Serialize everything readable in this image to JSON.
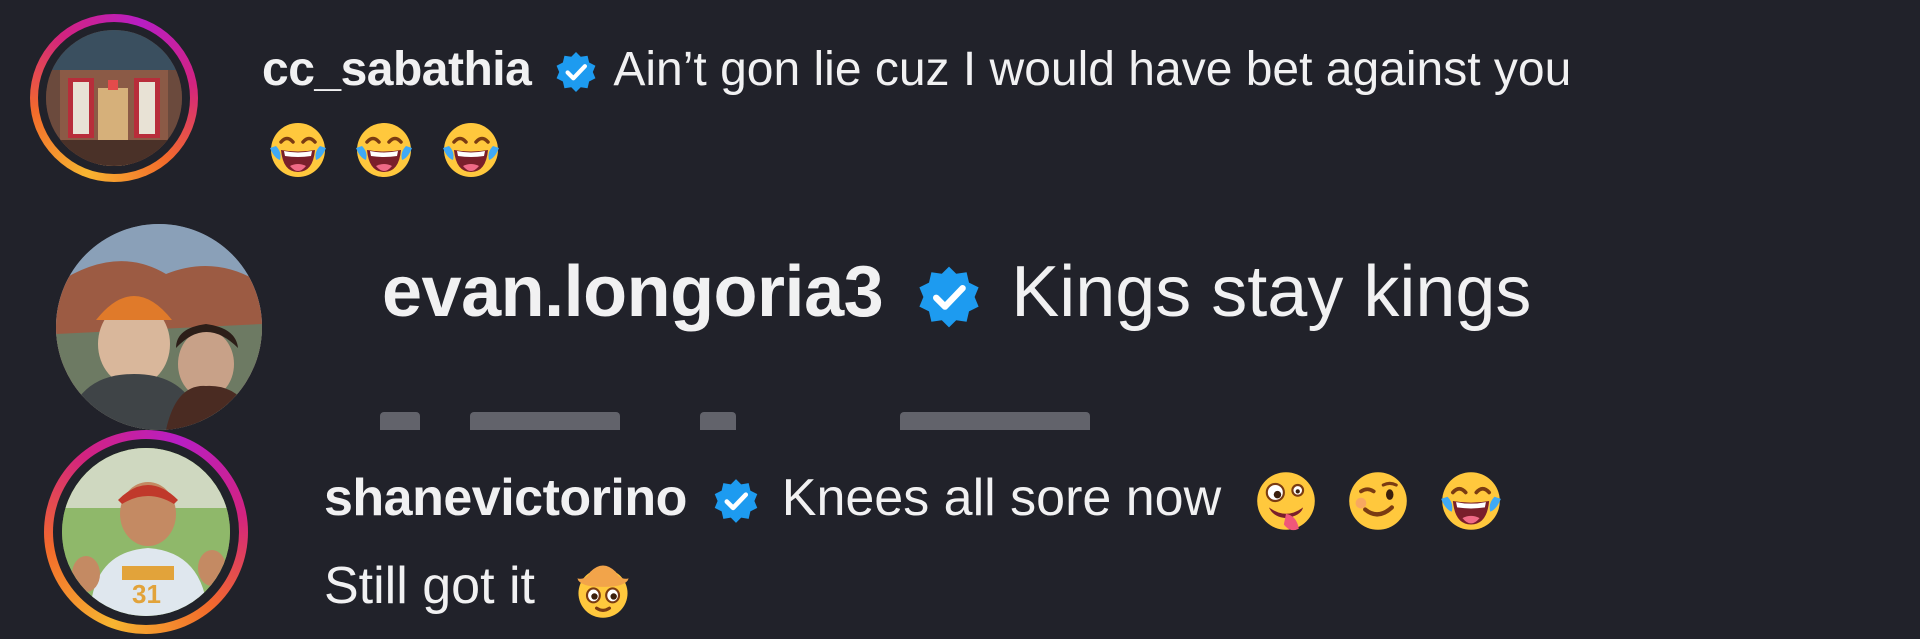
{
  "comments": [
    {
      "username": "cc_sabathia",
      "text": "Ain’t gon lie cuz I would have bet against you",
      "emoji": [
        "tears-of-joy",
        "tears-of-joy",
        "tears-of-joy"
      ]
    },
    {
      "username": "evan.longoria3",
      "text": "Kings stay kings"
    },
    {
      "username": "shanevictorino",
      "text": "Knees all sore now",
      "emoji_line1": [
        "zany-face",
        "winking-face",
        "tears-of-joy"
      ],
      "text_line2": "Still got it",
      "emoji_line2": [
        "cowboy-face"
      ]
    }
  ],
  "colors": {
    "background": "#21222a",
    "text": "#f1f1f2",
    "verified": "#1d9bf0",
    "story_ring": [
      "#f7b531",
      "#d3237f",
      "#b81ec4"
    ]
  }
}
